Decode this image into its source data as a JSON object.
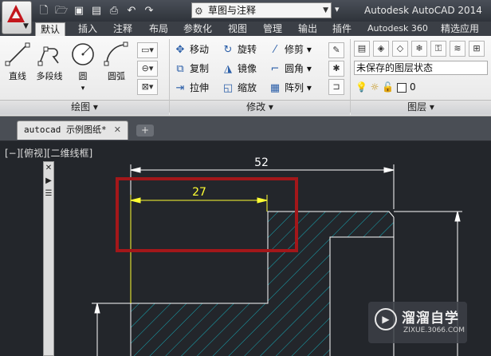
{
  "app": {
    "title": "Autodesk AutoCAD 2014",
    "workspace": "草图与注释"
  },
  "quick_access": [
    "new-icon",
    "open-icon",
    "save-icon",
    "saveas-icon",
    "print-icon",
    "undo-icon",
    "redo-icon"
  ],
  "tabs": [
    {
      "label": "默认",
      "active": true
    },
    {
      "label": "插入"
    },
    {
      "label": "注释"
    },
    {
      "label": "布局"
    },
    {
      "label": "参数化"
    },
    {
      "label": "视图"
    },
    {
      "label": "管理"
    },
    {
      "label": "输出"
    },
    {
      "label": "插件"
    },
    {
      "label": "Autodesk 360"
    },
    {
      "label": "精选应用"
    }
  ],
  "draw_panel": {
    "title": "绘图 ▾",
    "tools": [
      {
        "label": "直线",
        "icon": "line-icon"
      },
      {
        "label": "多段线",
        "icon": "polyline-icon"
      },
      {
        "label": "圆",
        "icon": "circle-icon"
      },
      {
        "label": "圆弧",
        "icon": "arc-icon"
      }
    ]
  },
  "modify_panel": {
    "title": "修改 ▾",
    "tools": [
      {
        "label": "移动",
        "icon": "move-icon"
      },
      {
        "label": "旋转",
        "icon": "rotate-icon"
      },
      {
        "label": "修剪 ▾",
        "icon": "trim-icon"
      },
      {
        "label": "复制",
        "icon": "copy-icon"
      },
      {
        "label": "镜像",
        "icon": "mirror-icon"
      },
      {
        "label": "圆角 ▾",
        "icon": "fillet-icon"
      },
      {
        "label": "拉伸",
        "icon": "stretch-icon"
      },
      {
        "label": "缩放",
        "icon": "scale-icon"
      },
      {
        "label": "阵列 ▾",
        "icon": "array-icon"
      }
    ]
  },
  "layers_panel": {
    "title": "图层 ▾",
    "layer_state": "未保存的图层状态",
    "current_layer": "0"
  },
  "document": {
    "tab_label": "autocad 示例图纸*",
    "close": "✕"
  },
  "viewport": {
    "controls": "[−][俯视][二维线框]"
  },
  "drawing": {
    "dim_overall": "52",
    "dim_highlight": "27"
  },
  "watermark": {
    "title": "溜溜自学",
    "subtitle": "ZIXUE.3066.COM"
  },
  "colors": {
    "highlight_box": "#a3171a",
    "dimension": "#ffffff",
    "dim_highlight": "#ffff33",
    "hatch": "#17a9b5",
    "geometry": "#ffffff"
  }
}
